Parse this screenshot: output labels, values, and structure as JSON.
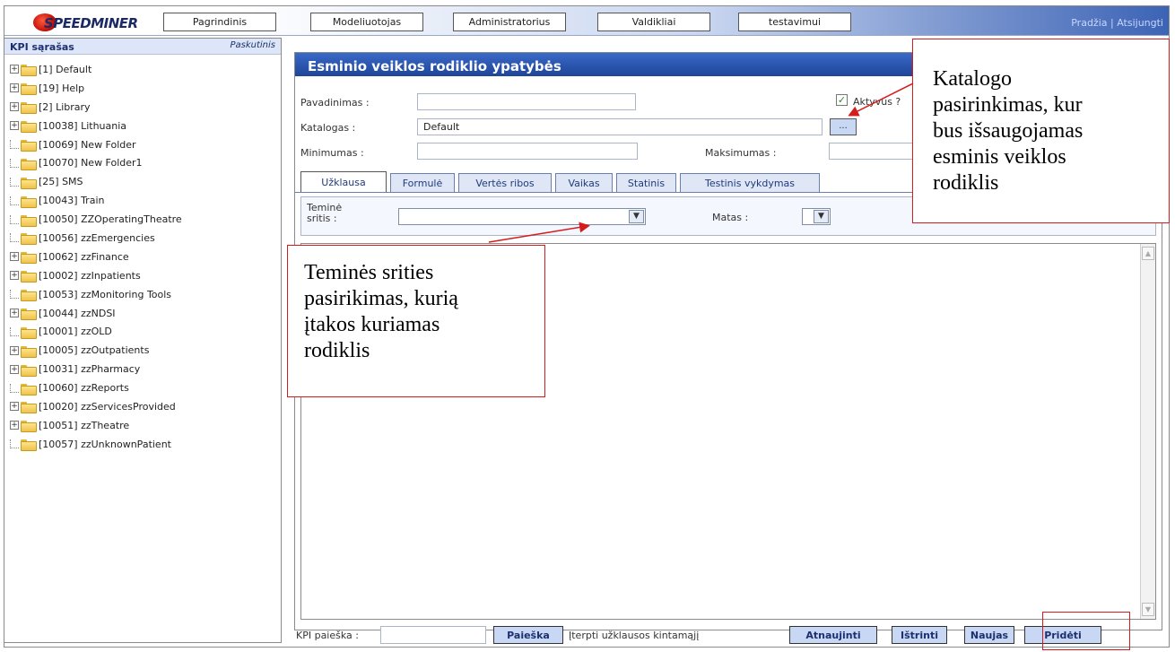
{
  "app": {
    "logo_text": "SPEEDMINER"
  },
  "nav": {
    "items": [
      "Pagrindinis",
      "Modeliuotojas",
      "Administratorius",
      "Valdikliai",
      "testavimui"
    ],
    "links": {
      "home": "Pradžia",
      "separator": " | ",
      "logout": "Atsijungti"
    }
  },
  "sidebar": {
    "title": "KPI sąrašas",
    "last_label": "Paskutinis",
    "items": [
      {
        "label": "[1] Default",
        "expandable": true
      },
      {
        "label": "[19] Help",
        "expandable": true
      },
      {
        "label": "[2] Library",
        "expandable": true
      },
      {
        "label": "[10038] Lithuania",
        "expandable": true
      },
      {
        "label": "[10069] New Folder",
        "expandable": false
      },
      {
        "label": "[10070] New Folder1",
        "expandable": false
      },
      {
        "label": "[25] SMS",
        "expandable": false
      },
      {
        "label": "[10043] Train",
        "expandable": false
      },
      {
        "label": "[10050] ZZOperatingTheatre",
        "expandable": false
      },
      {
        "label": "[10056] zzEmergencies",
        "expandable": false
      },
      {
        "label": "[10062] zzFinance",
        "expandable": true
      },
      {
        "label": "[10002] zzInpatients",
        "expandable": true
      },
      {
        "label": "[10053] zzMonitoring Tools",
        "expandable": false
      },
      {
        "label": "[10044] zzNDSI",
        "expandable": true
      },
      {
        "label": "[10001] zzOLD",
        "expandable": false
      },
      {
        "label": "[10005] zzOutpatients",
        "expandable": true
      },
      {
        "label": "[10031] zzPharmacy",
        "expandable": true
      },
      {
        "label": "[10060] zzReports",
        "expandable": false
      },
      {
        "label": "[10020] zzServicesProvided",
        "expandable": true
      },
      {
        "label": "[10051] zzTheatre",
        "expandable": true
      },
      {
        "label": "[10057] zzUnknownPatient",
        "expandable": false
      }
    ]
  },
  "main": {
    "title": "Esminio veiklos rodiklio ypatybės",
    "form": {
      "name_label": "Pavadinimas :",
      "name_value": "",
      "catalog_label": "Katalogas :",
      "catalog_value": "Default",
      "catalog_button": "...",
      "min_label": "Minimumas :",
      "min_value": "",
      "max_label": "Maksimumas :",
      "max_value": "",
      "active_label": "Aktyvus ?",
      "active_checked": true
    },
    "tabs": [
      "Užklausa",
      "Formulė",
      "Vertės ribos",
      "Vaikas",
      "Statinis",
      "Testinis vykdymas"
    ],
    "active_tab": "Užklausa",
    "query": {
      "area_label_line1": "Teminė",
      "area_label_line2": "sritis :",
      "area_value": "",
      "measure_label": "Matas :",
      "measure_value": ""
    }
  },
  "bottom": {
    "search_label": "KPI paieška :",
    "search_value": "",
    "search_button": "Paieška",
    "insert_variable": "Įterpti užklausos kintamąjį",
    "refresh_button": "Atnaujinti",
    "delete_button": "Ištrinti",
    "new_button": "Naujas",
    "add_button": "Pridėti"
  },
  "annotations": {
    "catalog_callout": [
      "Katalogo",
      "pasirinkimas, kur",
      "bus išsaugojamas",
      "esminis veiklos",
      "rodiklis"
    ],
    "area_callout": [
      "Teminės srities",
      "pasirikimas, kurią",
      "įtakos kuriamas",
      "rodiklis"
    ],
    "accent_color": "#d41c1c"
  }
}
